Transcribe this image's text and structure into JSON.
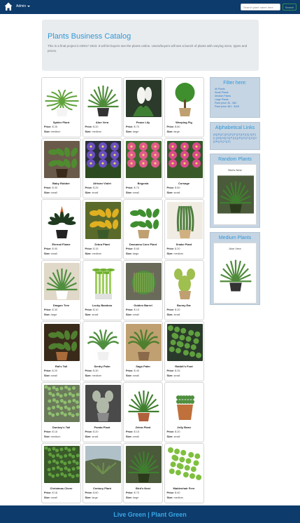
{
  "navbar": {
    "home_icon": "home-icon",
    "admin_label": "Admin",
    "search_placeholder": "Search plant name here",
    "search_label": "Search",
    "colors": {
      "navbar_bg": "#0d3b6b",
      "search_button": "#2f8f4f"
    }
  },
  "jumbotron": {
    "title": "Plants Business Catalog",
    "text": "This is a final project in DM17 2023. It will let buyers see the plants online. Users/buyers will see a bunch of plants with varying sizes, types and prices."
  },
  "labels": {
    "price": "Price:",
    "size": "Size:"
  },
  "plants": [
    {
      "name": "Spider Plant",
      "price": "$ 25",
      "size": "medium",
      "icon": "spider-plant-photo"
    },
    {
      "name": "Aloe Vera",
      "price": "$ 20",
      "size": "medium",
      "icon": "aloe-vera-photo"
    },
    {
      "name": "Peace Lily",
      "price": "$ 70",
      "size": "large",
      "icon": "peace-lily-photo"
    },
    {
      "name": "Weeping Fig",
      "price": "$ 80",
      "size": "large",
      "icon": "weeping-fig-photo"
    },
    {
      "name": "Baby Rubber",
      "price": "$ 30",
      "size": "small",
      "icon": "baby-rubber-photo"
    },
    {
      "name": "African Violet",
      "price": "$ 25",
      "size": "small",
      "icon": "african-violet-photo"
    },
    {
      "name": "Begonia",
      "price": "$ 70",
      "size": "small",
      "icon": "begonia-photo"
    },
    {
      "name": "Corsage",
      "price": "$ 50",
      "size": "small",
      "icon": "corsage-photo"
    },
    {
      "name": "Eternal Flame",
      "price": "$ 90",
      "size": "small",
      "icon": "eternal-flame-photo"
    },
    {
      "name": "Zebra Plant",
      "price": "$ 15",
      "size": "medium",
      "icon": "zebra-plant-photo"
    },
    {
      "name": "Dracaena Corn Plant",
      "price": "$ 65",
      "size": "large",
      "icon": "dracaena-photo"
    },
    {
      "name": "Snake Plant",
      "price": "$ 20",
      "size": "medium",
      "icon": "snake-plant-photo"
    },
    {
      "name": "Dragon Tree",
      "price": "$ 30",
      "size": "large",
      "icon": "dragon-tree-photo"
    },
    {
      "name": "Lucky Bamboo",
      "price": "$ 10",
      "size": "small",
      "icon": "lucky-bamboo-photo"
    },
    {
      "name": "Golden Barrel",
      "price": "$ 10",
      "size": "small",
      "icon": "golden-barrel-photo"
    },
    {
      "name": "Bunny Ear",
      "price": "$ 20",
      "size": "small",
      "icon": "bunny-ear-photo"
    },
    {
      "name": "Rat's Tail",
      "price": "$ 20",
      "size": "small",
      "icon": "rats-tail-photo"
    },
    {
      "name": "Sentry Palm",
      "price": "$ 30",
      "size": "medium",
      "icon": "sentry-palm-photo"
    },
    {
      "name": "Sago Palm",
      "price": "$ 40",
      "size": "small",
      "icon": "sago-palm-photo"
    },
    {
      "name": "Rabbit's Foot",
      "price": "$ 25",
      "size": "small",
      "icon": "rabbits-foot-photo"
    },
    {
      "name": "Donkey's Tail",
      "price": "$ 18",
      "size": "medium",
      "icon": "donkeys-tail-photo"
    },
    {
      "name": "Panda Plant",
      "price": "$ 20",
      "size": "small",
      "icon": "panda-plant-photo"
    },
    {
      "name": "Zebra Plant",
      "price": "$ 15",
      "size": "small",
      "icon": "zebra-haworthia-photo"
    },
    {
      "name": "Jelly Bean",
      "price": "$ 20",
      "size": "small",
      "icon": "jelly-bean-photo"
    },
    {
      "name": "Christmas Cheer",
      "price": "$ 18",
      "size": "small",
      "icon": "christmas-cheer-photo"
    },
    {
      "name": "Century Plant",
      "price": "$ 60",
      "size": "large",
      "icon": "century-plant-photo"
    },
    {
      "name": "Bird's Nest",
      "price": "$ 70",
      "size": "large",
      "icon": "birds-nest-photo"
    },
    {
      "name": "Maidenhair Fern",
      "price": "$ 40",
      "size": "medium",
      "icon": "maidenhair-fern-photo"
    }
  ],
  "sidebar": {
    "filter_title": "Filter here:",
    "filter_links": [
      "All Plants",
      "Small Plants",
      "Medium Plants",
      "Large Plants",
      "Plant price: $1 - $40",
      "Plant price: $41 - $100"
    ],
    "alpha_title": "Alphabetical Links",
    "alpha_letters": [
      "A",
      "B",
      "C",
      "D",
      "E",
      "F",
      "G",
      "H",
      "I",
      "J",
      "K",
      "L",
      "M",
      "N",
      "O",
      "P",
      "Q",
      "R",
      "S",
      "T",
      "U",
      "V",
      "W",
      "X",
      "Y",
      "Z"
    ],
    "random_title": "Random Plants",
    "random_plant": "Bird's Nest",
    "medium_title": "Medium Plants",
    "medium_plant": "Aloe Vera"
  },
  "footer": {
    "text": "Live Green | Plant Green"
  },
  "colors": {
    "accent": "#2f97d6",
    "sidebar_bg": "#c6d5e3",
    "footer_text": "#38a7e8"
  }
}
